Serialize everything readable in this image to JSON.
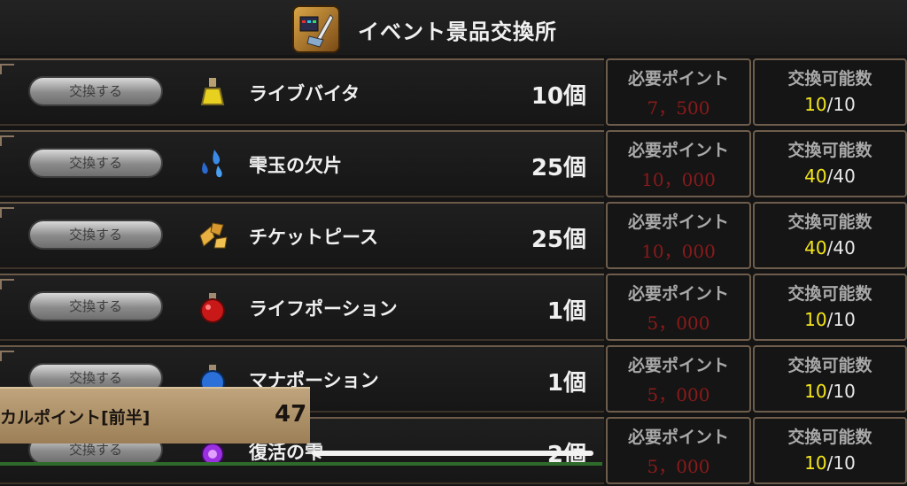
{
  "header": {
    "title": "イベント景品交換所",
    "icon": "treasure-sword-icon"
  },
  "items": [
    {
      "button": "交換する",
      "name": "ライブバイタ",
      "qty": "10個",
      "points_label": "必要ポイント",
      "points": "7，500",
      "limit_label": "交換可能数",
      "limit_current": "10",
      "limit_max": "10",
      "icon": "flask-yellow-icon"
    },
    {
      "button": "交換する",
      "name": "雫玉の欠片",
      "qty": "25個",
      "points_label": "必要ポイント",
      "points": "10，000",
      "limit_label": "交換可能数",
      "limit_current": "40",
      "limit_max": "40",
      "icon": "blue-drops-icon"
    },
    {
      "button": "交換する",
      "name": "チケットピース",
      "qty": "25個",
      "points_label": "必要ポイント",
      "points": "10，000",
      "limit_label": "交換可能数",
      "limit_current": "40",
      "limit_max": "40",
      "icon": "ticket-pieces-icon"
    },
    {
      "button": "交換する",
      "name": "ライフポーション",
      "qty": "1個",
      "points_label": "必要ポイント",
      "points": "5，000",
      "limit_label": "交換可能数",
      "limit_current": "10",
      "limit_max": "10",
      "icon": "red-potion-icon"
    },
    {
      "button": "交換する",
      "name": "マナポーション",
      "qty": "1個",
      "points_label": "必要ポイント",
      "points": "5，000",
      "limit_label": "交換可能数",
      "limit_current": "10",
      "limit_max": "10",
      "icon": "blue-potion-icon"
    },
    {
      "button": "交換する",
      "name": "復活の雫",
      "qty": "2個",
      "points_label": "必要ポイント",
      "points": "5，000",
      "limit_label": "交換可能数",
      "limit_current": "10",
      "limit_max": "10",
      "icon": "purple-orb-icon"
    }
  ],
  "overlay": {
    "label": "カルポイント[前半]",
    "value": "47"
  },
  "colors": {
    "points": "#8a1a1a",
    "limit_current": "#f5e61a",
    "frame": "#6e5d4c"
  }
}
